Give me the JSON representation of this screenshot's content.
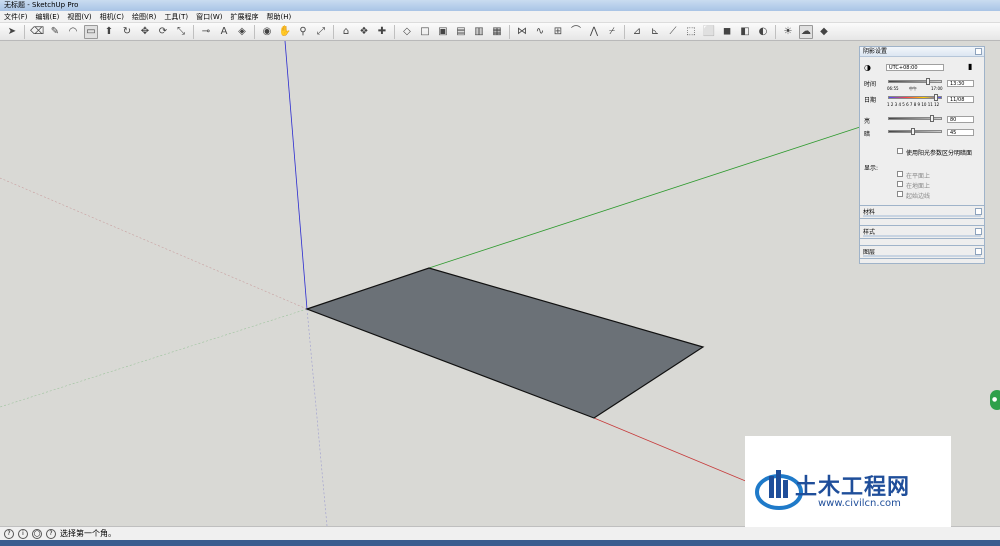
{
  "window": {
    "title": "无标题 - SketchUp Pro"
  },
  "menus": [
    "文件(F)",
    "编辑(E)",
    "视图(V)",
    "相机(C)",
    "绘图(R)",
    "工具(T)",
    "窗口(W)",
    "扩展程序",
    "帮助(H)"
  ],
  "shadow_panel": {
    "title": "阴影设置",
    "timezone": "UTC+08:00",
    "time_label": "时间",
    "time_start": "06:55",
    "time_noon": "中午",
    "time_end": "17:00",
    "time_value": "13:30",
    "date_label": "日期",
    "months": "1 2 3 4 5 6 7 8 9 10 11 12",
    "date_value": "11/08",
    "light_label": "亮",
    "light_value": "80",
    "dark_label": "暗",
    "dark_value": "45",
    "sun_shading": "使用阳光参数区分明暗面",
    "display_label": "显示:",
    "on_faces": "在平面上",
    "on_ground": "在地面上",
    "from_edges": "起始边线"
  },
  "collapsed_panels": [
    "材料",
    "样式",
    "图层"
  ],
  "status": {
    "message": "选择第一个角。"
  },
  "watermark": {
    "text": "土木工程网",
    "url": "www.civilcn.com"
  },
  "colors": {
    "face": "#6b7177",
    "axis_red": "#c63a3a",
    "axis_green": "#2e9a2e",
    "axis_blue": "#2b2bd0",
    "viewport_bg": "#d9d9d5"
  }
}
